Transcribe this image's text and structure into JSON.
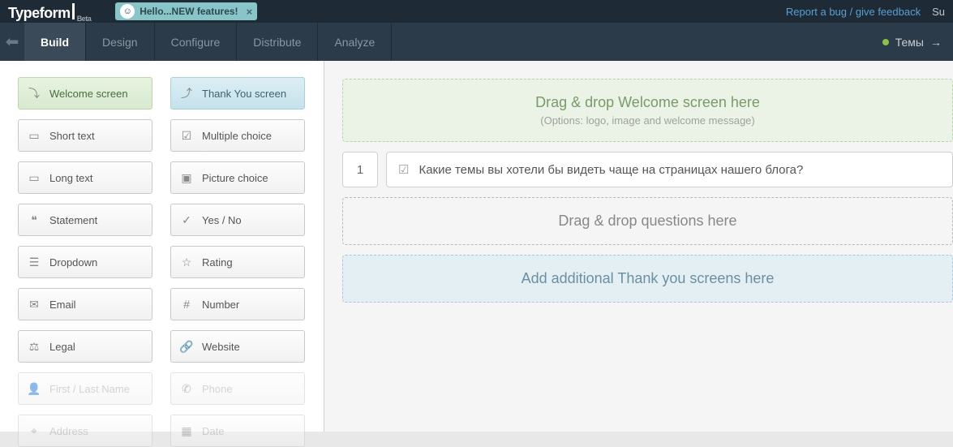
{
  "header": {
    "logo": "Typeform",
    "beta": "Beta",
    "notification": "Hello...NEW features!",
    "feedback": "Report a bug / give feedback",
    "right_trunc": "Su"
  },
  "tabs": {
    "build": "Build",
    "design": "Design",
    "configure": "Configure",
    "distribute": "Distribute",
    "analyze": "Analyze"
  },
  "project": {
    "name": "Темы",
    "arrow": "→"
  },
  "blocks": {
    "welcome": "Welcome screen",
    "thankyou": "Thank You screen",
    "short_text": "Short text",
    "multiple_choice": "Multiple choice",
    "long_text": "Long text",
    "picture_choice": "Picture choice",
    "statement": "Statement",
    "yes_no": "Yes / No",
    "dropdown": "Dropdown",
    "rating": "Rating",
    "email": "Email",
    "number": "Number",
    "legal": "Legal",
    "website": "Website",
    "name": "First / Last Name",
    "phone": "Phone",
    "address": "Address",
    "date": "Date"
  },
  "canvas": {
    "welcome_title": "Drag & drop Welcome screen here",
    "welcome_sub": "(Options: logo, image and welcome message)",
    "q1_num": "1",
    "q1_text": "Какие темы вы хотели бы видеть чаще на страницах нашего блога?",
    "questions_dz": "Drag & drop questions here",
    "thankyou_dz": "Add additional Thank you screens here"
  }
}
